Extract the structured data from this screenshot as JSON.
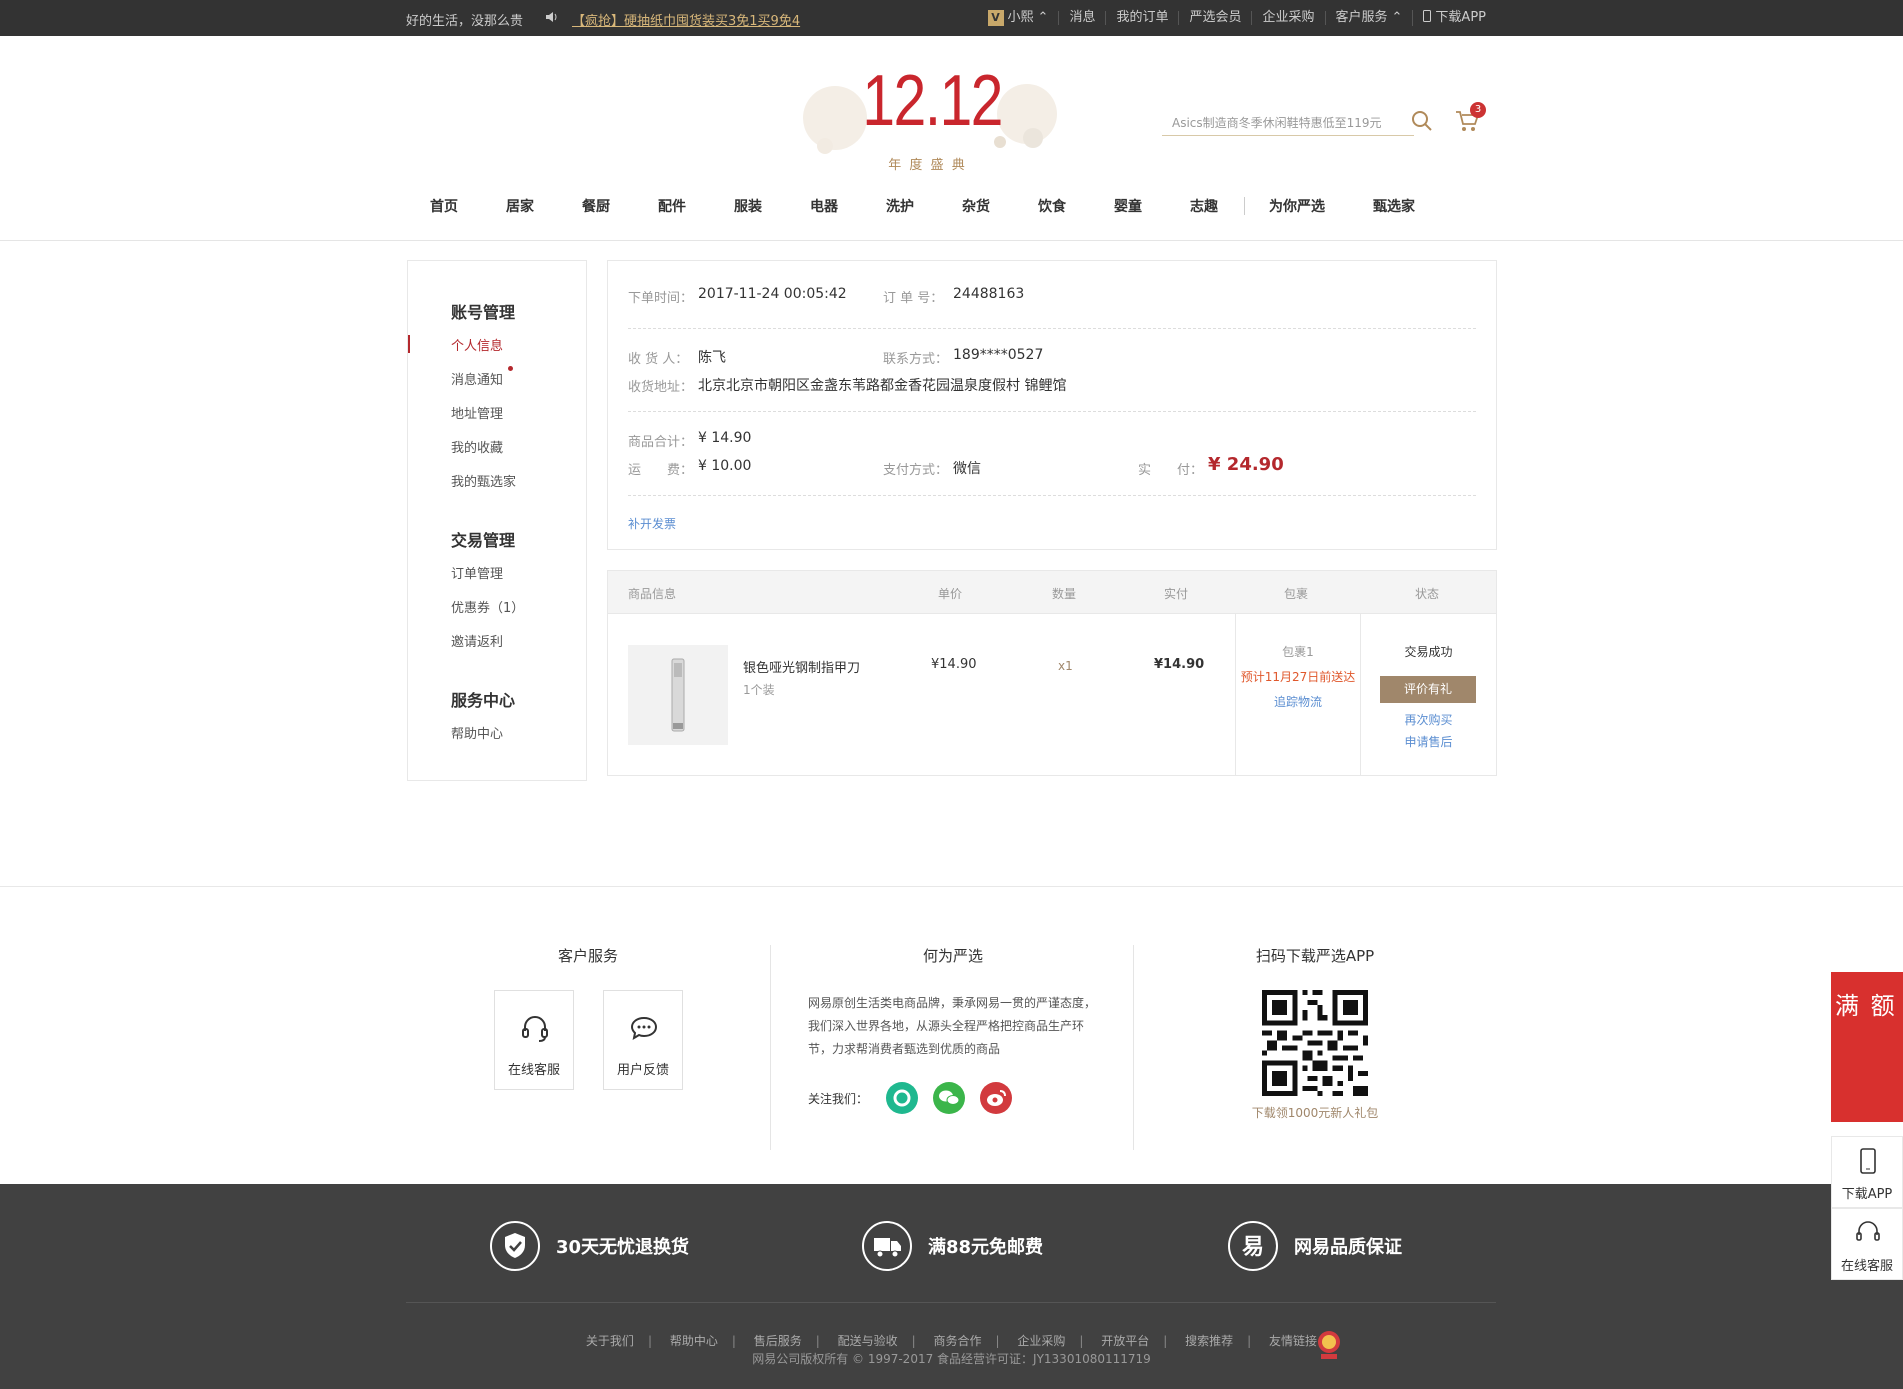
{
  "topbar": {
    "slogan": "好的生活，没那么贵",
    "promo": "【疯抢】硬抽纸巾囤货装买3免1买9免4",
    "user": "小熙",
    "user_badge": "V",
    "links": [
      "消息",
      "我的订单",
      "严选会员",
      "企业采购",
      "客户服务",
      "下载APP"
    ]
  },
  "header": {
    "logo_main": "12.12",
    "logo_sub": "年 度 盛 典",
    "search_placeholder": "Asics制造商冬季休闲鞋特惠低至119元",
    "cart_count": "3"
  },
  "nav": [
    "首页",
    "居家",
    "餐厨",
    "配件",
    "服装",
    "电器",
    "洗护",
    "杂货",
    "饮食",
    "婴童",
    "志趣"
  ],
  "nav_extra": [
    "为你严选",
    "甄选家"
  ],
  "sidebar": {
    "groups": [
      {
        "title": "账号管理",
        "items": [
          "个人信息",
          "消息通知",
          "地址管理",
          "我的收藏",
          "我的甄选家"
        ]
      },
      {
        "title": "交易管理",
        "items": [
          "订单管理",
          "优惠券（1）",
          "邀请返利"
        ]
      },
      {
        "title": "服务中心",
        "items": [
          "帮助中心"
        ]
      }
    ]
  },
  "order": {
    "time_label": "下单时间：",
    "time": "2017-11-24 00:05:42",
    "no_label": "订 单 号：",
    "no": "24488163",
    "receiver_label": "收 货 人：",
    "receiver": "陈飞",
    "phone_label": "联系方式：",
    "phone": "189****0527",
    "addr_label": "收货地址：",
    "addr": "北京北京市朝阳区金盏东苇路都金香花园温泉度假村 锦鲤馆",
    "subtotal_label": "商品合计：",
    "subtotal": "¥ 14.90",
    "ship_label": "运　　费：",
    "ship": "¥ 10.00",
    "pay_label": "支付方式：",
    "pay": "微信",
    "paid_label": "实　　付：",
    "paid": "¥ 24.90",
    "invoice": "补开发票"
  },
  "goods": {
    "headers": [
      "商品信息",
      "单价",
      "数量",
      "实付",
      "包裹",
      "状态"
    ],
    "name": "银色哑光钢制指甲刀",
    "spec": "1个装",
    "price": "¥14.90",
    "qty": "x1",
    "paid": "¥14.90",
    "package": "包裹1",
    "eta": "预计11月27日前送达",
    "track": "追踪物流",
    "status": "交易成功",
    "review_btn": "评价有礼",
    "rebuy": "再次购买",
    "aftersale": "申请售后"
  },
  "footer": {
    "service_title": "客户服务",
    "online": "在线客服",
    "feedback": "用户反馈",
    "about_title": "何为严选",
    "about_text": "网易原创生活类电商品牌，秉承网易一贯的严谨态度，我们深入世界各地，从源头全程严格把控商品生产环节，力求帮消费者甄选到优质的商品",
    "follow": "关注我们：",
    "app_title": "扫码下载严选APP",
    "app_gift": "下载领1000元新人礼包",
    "features": [
      "30天无忧退换货",
      "满88元免邮费",
      "网易品质保证"
    ],
    "links": [
      "关于我们",
      "帮助中心",
      "售后服务",
      "配送与验收",
      "商务合作",
      "企业采购",
      "开放平台",
      "搜索推荐",
      "友情链接"
    ],
    "copyright": "网易公司版权所有 © 1997-2017   食品经营许可证：JY13301080111719"
  },
  "float": {
    "promo": "满 额",
    "download": "下载APP",
    "service": "在线客服"
  },
  "colors": {
    "brand_red": "#b4282d",
    "gold": "#a0876b",
    "dark": "#333333"
  }
}
